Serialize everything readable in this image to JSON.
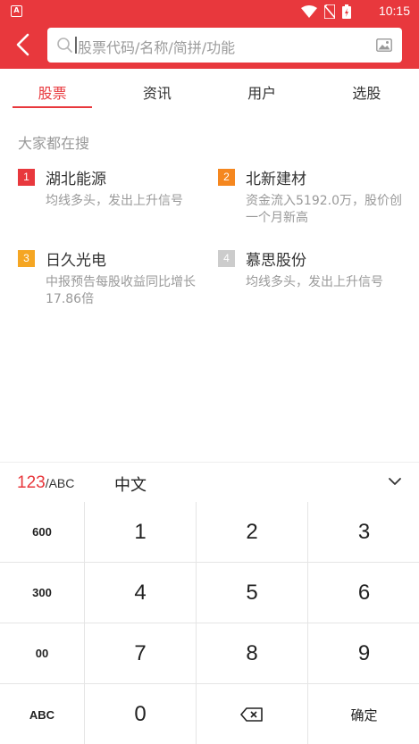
{
  "status_bar": {
    "time": "10:15",
    "app_icon_letter": "A"
  },
  "search": {
    "placeholder": "股票代码/名称/简拼/功能"
  },
  "tabs": [
    {
      "label": "股票",
      "active": true
    },
    {
      "label": "资讯",
      "active": false
    },
    {
      "label": "用户",
      "active": false
    },
    {
      "label": "选股",
      "active": false
    }
  ],
  "hot": {
    "title": "大家都在搜",
    "items": [
      {
        "rank": "1",
        "name": "湖北能源",
        "desc": "均线多头，发出上升信号",
        "color": "#e8383d"
      },
      {
        "rank": "2",
        "name": "北新建材",
        "desc": "资金流入5192.0万，股价创一个月新高",
        "color": "#f5871f"
      },
      {
        "rank": "3",
        "name": "日久光电",
        "desc": "中报预告每股收益同比增长17.86倍",
        "color": "#f5a623"
      },
      {
        "rank": "4",
        "name": "慕思股份",
        "desc": "均线多头，发出上升信号",
        "color": "#cccccc"
      }
    ]
  },
  "keyboard": {
    "mode_num": "123",
    "mode_abc": "/ABC",
    "chinese": "中文",
    "side_keys": [
      "600",
      "300",
      "00",
      "ABC"
    ],
    "digits": [
      "1",
      "2",
      "3",
      "4",
      "5",
      "6",
      "7",
      "8",
      "9",
      "0"
    ],
    "confirm": "确定"
  },
  "colors": {
    "accent": "#e8383d"
  }
}
